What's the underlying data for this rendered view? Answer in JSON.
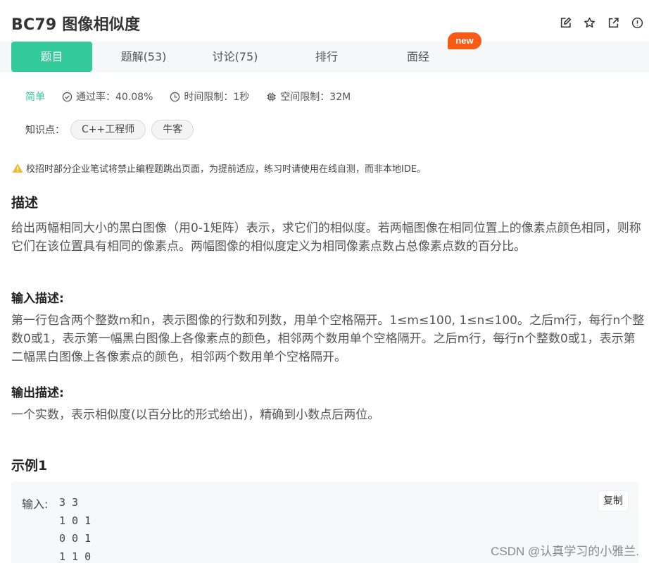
{
  "header": {
    "title": "BC79  图像相似度",
    "icons": [
      "edit-icon",
      "star-icon",
      "open-external-icon",
      "info-icon"
    ]
  },
  "tabs": [
    {
      "label": "题目",
      "active": true
    },
    {
      "label": "题解(53)",
      "active": false
    },
    {
      "label": "讨论(75)",
      "active": false
    },
    {
      "label": "排行",
      "active": false
    },
    {
      "label": "面经",
      "active": false
    }
  ],
  "new_badge": "new",
  "meta": {
    "difficulty": "简单",
    "pass_rate": "通过率：40.08%",
    "time_limit": "时间限制：1秒",
    "space_limit": "空间限制：32M"
  },
  "knowledge": {
    "label": "知识点：",
    "tags": [
      "C++工程师",
      "牛客"
    ]
  },
  "warning": "校招时部分企业笔试将禁止编程题跳出页面，为提前适应，练习时请使用在线自测，而非本地IDE。",
  "description": {
    "heading": "描述",
    "text": "给出两幅相同大小的黑白图像（用0-1矩阵）表示，求它们的相似度。若两幅图像在相同位置上的像素点颜色相同，则称它们在该位置具有相同的像素点。两幅图像的相似度定义为相同像素点数占总像素点数的百分比。"
  },
  "input_desc": {
    "heading": "输入描述:",
    "text": "第一行包含两个整数m和n，表示图像的行数和列数，用单个空格隔开。1≤m≤100, 1≤n≤100。之后m行，每行n个整数0或1，表示第一幅黑白图像上各像素点的颜色，相邻两个数用单个空格隔开。之后m行，每行n个整数0或1，表示第二幅黑白图像上各像素点的颜色，相邻两个数用单个空格隔开。"
  },
  "output_desc": {
    "heading": "输出描述:",
    "text": "一个实数，表示相似度(以百分比的形式给出)，精确到小数点后两位。"
  },
  "example": {
    "heading": "示例1",
    "input_label": "输入:",
    "input_lines": [
      "3 3",
      "1 0 1",
      "0 0 1",
      "1 1 0"
    ],
    "copy_label": "复制"
  },
  "watermark": "CSDN @认真学习的小雅兰."
}
